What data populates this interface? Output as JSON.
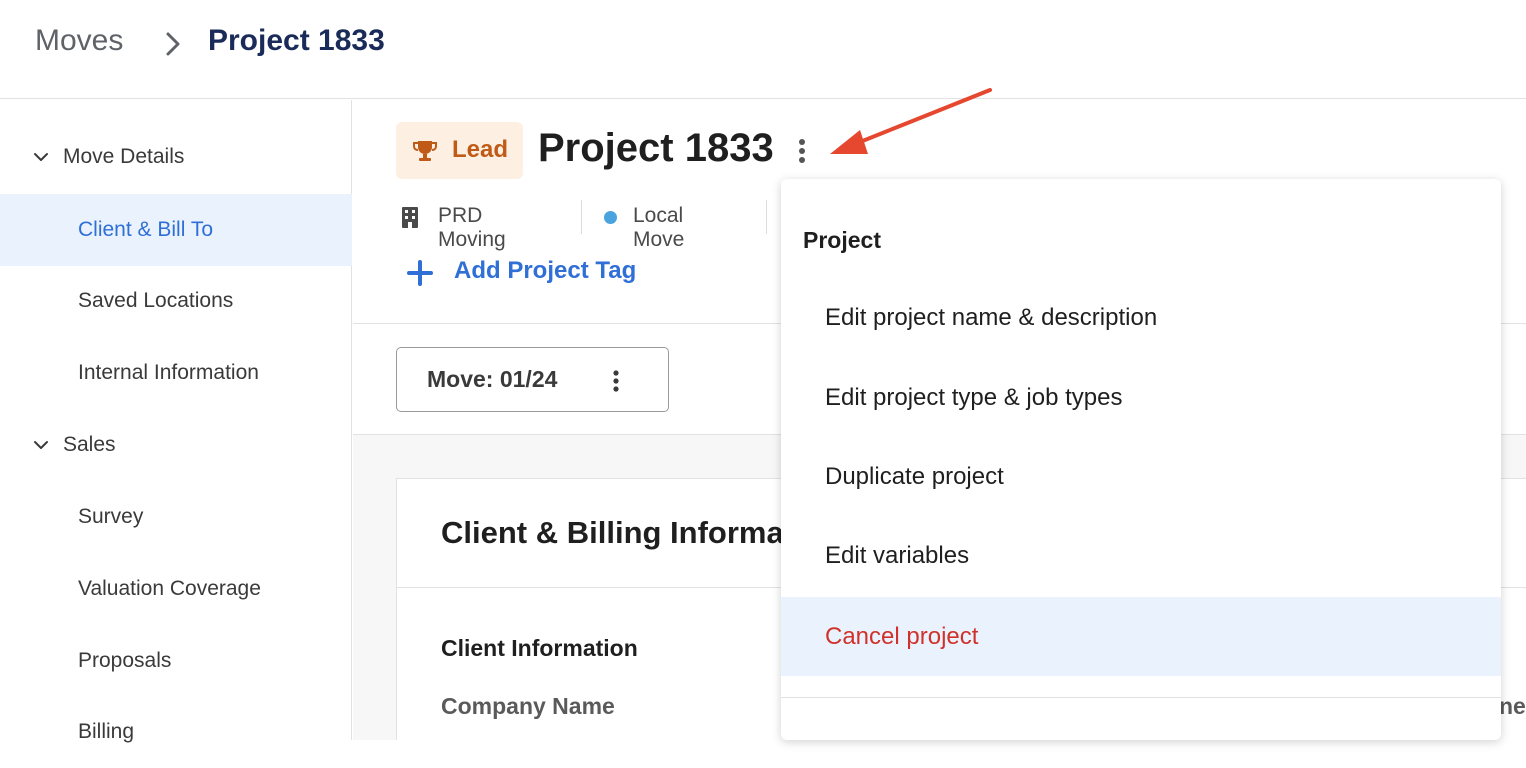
{
  "breadcrumb": {
    "root": "Moves",
    "current": "Project 1833"
  },
  "sidebar": {
    "groups": [
      {
        "label": "Move Details",
        "items": [
          {
            "label": "Client & Bill To"
          },
          {
            "label": "Saved Locations"
          },
          {
            "label": "Internal Information"
          }
        ]
      },
      {
        "label": "Sales",
        "items": [
          {
            "label": "Survey"
          },
          {
            "label": "Valuation Coverage"
          },
          {
            "label": "Proposals"
          },
          {
            "label": "Billing"
          }
        ]
      }
    ],
    "active_item": "Client & Bill To"
  },
  "project": {
    "status_badge": "Lead",
    "title": "Project 1833",
    "company": "PRD Moving",
    "move_type": "Local Move",
    "add_tag_label": "Add Project Tag"
  },
  "move_selector": {
    "label": "Move: 01/24"
  },
  "card": {
    "title": "Client & Billing Informa",
    "section": "Client Information",
    "field_label": "Company Name",
    "right_fragment": "ne"
  },
  "menu": {
    "heading": "Project",
    "items": [
      {
        "label": "Edit project name & description"
      },
      {
        "label": "Edit project type & job types"
      },
      {
        "label": "Duplicate project"
      },
      {
        "label": "Edit variables"
      },
      {
        "label": "Cancel project"
      }
    ]
  },
  "colors": {
    "accent_blue": "#2f6fd6",
    "active_bg": "#eaf3fd",
    "lead_bg": "#fdf0e3",
    "lead_text": "#c05a17",
    "danger": "#d0322b",
    "annotation_arrow": "#e5472f",
    "move_type_dot": "#4aa3df"
  }
}
